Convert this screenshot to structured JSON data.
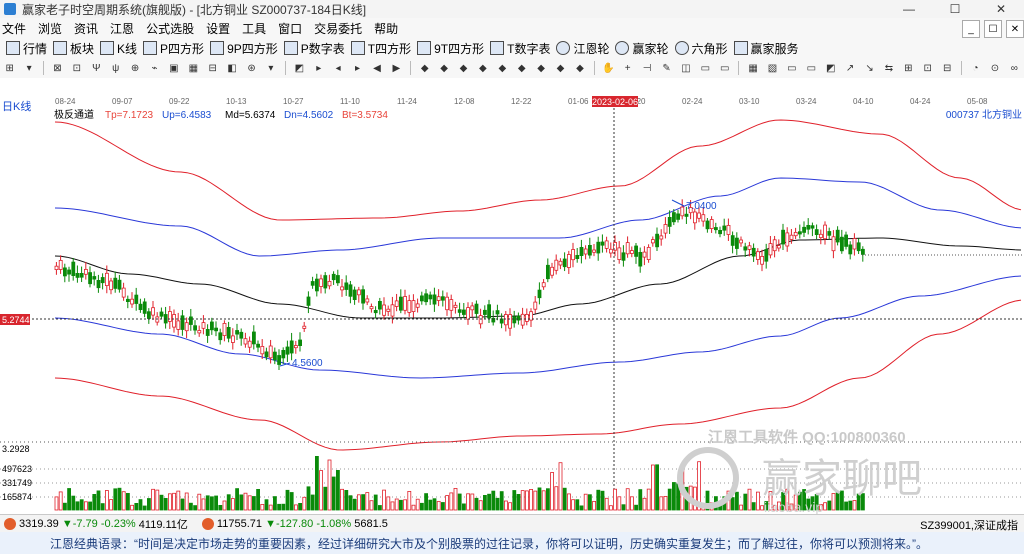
{
  "window": {
    "title": "赢家老子时空周期系统(旗舰版) - [北方铜业  SZ000737-184日K线]",
    "controls": [
      "—",
      "☐",
      "✕"
    ]
  },
  "menu": [
    "文件",
    "浏览",
    "资讯",
    "江恩",
    "公式选股",
    "设置",
    "工具",
    "窗口",
    "交易委托",
    "帮助"
  ],
  "submenu_controls": [
    "_",
    "☐",
    "✕"
  ],
  "toolbar1": [
    "行情",
    "板块",
    "K线",
    "P四方形",
    "9P四方形",
    "P数字表",
    "T四方形",
    "9T四方形",
    "T数字表",
    "江恩轮",
    "赢家轮",
    "六角形",
    "赢家服务"
  ],
  "toolbar2_icons": [
    "⊞",
    "▾",
    "⊠",
    "⊡",
    "Ψ",
    "ψ",
    "⊕",
    "⌁",
    "▣",
    "▦",
    "⊟",
    "◧",
    "⊛",
    "▾",
    "◩",
    "▸",
    "◂",
    "▸",
    "◀",
    "▶",
    "◆",
    "◆",
    "◆",
    "◆",
    "◆",
    "◆",
    "◆",
    "◆",
    "◆",
    "✋",
    "+",
    "⊣",
    "✎",
    "◫",
    "▭",
    "▭",
    "▦",
    "▧",
    "▭",
    "▭",
    "◩",
    "↗",
    "↘",
    "⇆",
    "⊞",
    "⊡",
    "⊟",
    "◔",
    "⊙",
    "∞"
  ],
  "chart": {
    "period_label": "日K线",
    "indicator": "极反通道",
    "tp": "Tp=7.1723",
    "up": "Up=6.4583",
    "md": "Md=5.6374",
    "dn": "Dn=4.5602",
    "bt": "Bt=3.5734",
    "code_name": "000737  北方铜业",
    "x_ticks": [
      "08-24",
      "09-07",
      "09-22",
      "10-13",
      "10-27",
      "11-10",
      "11-24",
      "12-08",
      "12-22",
      "01-06",
      "01-20",
      "02-24",
      "03-10",
      "03-24",
      "04-10",
      "04-24",
      "05-08",
      "05-22"
    ],
    "cursor_date": "2023-02-06",
    "cursor_price": "5.2744",
    "high_label": "7.0400",
    "low_label": "4.5600",
    "vol_ticks": [
      "3.2928",
      "497623",
      "331749",
      "165874"
    ],
    "watermark_line1": "江恩工具软件  QQ:100800360",
    "watermark_logo": "赢家聊吧",
    "watermark_sub": "iiaoba.vip"
  },
  "chart_data": {
    "type": "line",
    "title": "北方铜业 SZ000737 日K线",
    "xlabel": "",
    "ylabel": "",
    "x": [
      "08-24",
      "09-07",
      "09-22",
      "10-13",
      "10-27",
      "11-10",
      "11-24",
      "12-08",
      "12-22",
      "01-06",
      "01-20",
      "02-06",
      "02-24",
      "03-10",
      "03-24",
      "04-10",
      "04-24",
      "05-08",
      "05-22"
    ],
    "series": [
      {
        "name": "Tp",
        "values": [
          null,
          null,
          null,
          null,
          null,
          null,
          null,
          null,
          null,
          null,
          null,
          null,
          7.1723,
          null,
          null,
          null,
          null,
          null,
          null
        ]
      },
      {
        "name": "Up",
        "values": [
          null,
          null,
          null,
          null,
          null,
          null,
          null,
          null,
          null,
          null,
          null,
          null,
          6.4583,
          null,
          null,
          null,
          null,
          null,
          null
        ]
      },
      {
        "name": "Md",
        "values": [
          null,
          null,
          null,
          null,
          null,
          null,
          null,
          null,
          null,
          null,
          null,
          null,
          5.6374,
          null,
          null,
          null,
          null,
          null,
          null
        ]
      },
      {
        "name": "Dn",
        "values": [
          null,
          null,
          null,
          null,
          null,
          null,
          null,
          null,
          null,
          null,
          null,
          null,
          4.5602,
          null,
          null,
          null,
          null,
          null,
          null
        ]
      },
      {
        "name": "Bt",
        "values": [
          null,
          null,
          null,
          null,
          null,
          null,
          null,
          null,
          null,
          null,
          null,
          null,
          3.5734,
          null,
          null,
          null,
          null,
          null,
          null
        ]
      }
    ],
    "price_annotations": {
      "high": 7.04,
      "low": 4.56,
      "cursor": 5.2744
    },
    "volume_axis": [
      165874,
      331749,
      497623
    ],
    "grid": false
  },
  "status": {
    "sh_value": "3319.39",
    "sh_change": "▼-7.79",
    "sh_pct": "-0.23%",
    "sh_amount": "4119.11亿",
    "sz_value": "11755.71",
    "sz_change": "▼-127.80",
    "sz_pct": "-1.08%",
    "sz_amount": "5681.5",
    "right_text": "SZ399001,深证成指"
  },
  "quote": "江恩经典语录：“时间是决定市场走势的重要因素，经过详细研究大市及个别股票的过往记录，你将可以证明，历史确实重复发生；而了解过往，你将可以预测将来。”。"
}
